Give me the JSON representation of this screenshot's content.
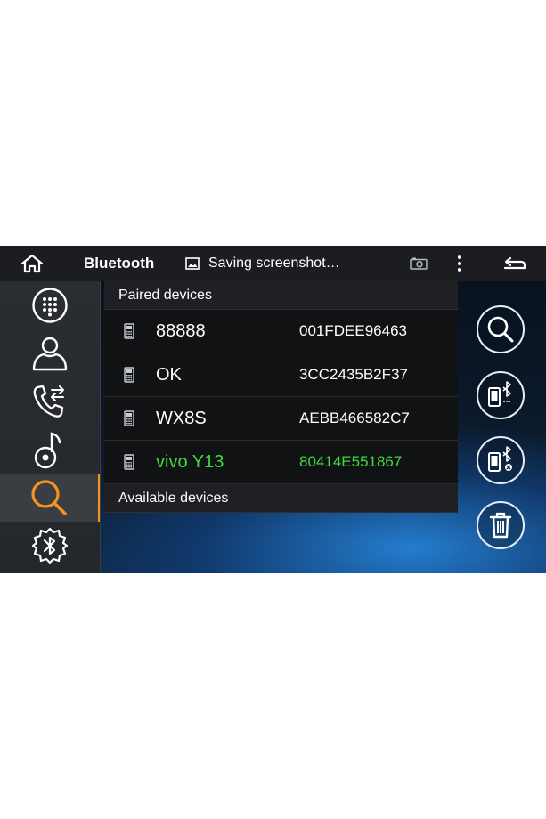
{
  "statusbar": {
    "app_title": "Bluetooth",
    "notification_text": "Saving screenshot…",
    "icons": [
      "home-icon",
      "image-icon",
      "screenshot-camera-icon",
      "overflow-menu-icon",
      "back-icon"
    ]
  },
  "nav": {
    "items": [
      {
        "name": "dialpad",
        "icon": "dialpad-icon"
      },
      {
        "name": "contacts",
        "icon": "contact-icon"
      },
      {
        "name": "call-log",
        "icon": "call-transfer-icon"
      },
      {
        "name": "music",
        "icon": "music-note-icon"
      },
      {
        "name": "search",
        "icon": "search-icon",
        "selected": true
      },
      {
        "name": "bluetooth-settings",
        "icon": "bluetooth-gear-icon"
      }
    ]
  },
  "devices": {
    "paired_header": "Paired devices",
    "available_header": "Available devices",
    "paired": [
      {
        "name": "88888",
        "address": "001FDEE96463",
        "connected": false
      },
      {
        "name": "OK",
        "address": "3CC2435B2F37",
        "connected": false
      },
      {
        "name": "WX8S",
        "address": "AEBB466582C7",
        "connected": false
      },
      {
        "name": "vivo Y13",
        "address": "80414E551867",
        "connected": true
      }
    ]
  },
  "actions": [
    "search-devices-icon",
    "connect-phone-icon",
    "disconnect-phone-icon",
    "delete-icon"
  ],
  "colors": {
    "accent": "#f4941d",
    "connected": "#3ddc3d",
    "statusbar_bg": "#1b1d20",
    "nav_bg": "#2a2d31"
  }
}
